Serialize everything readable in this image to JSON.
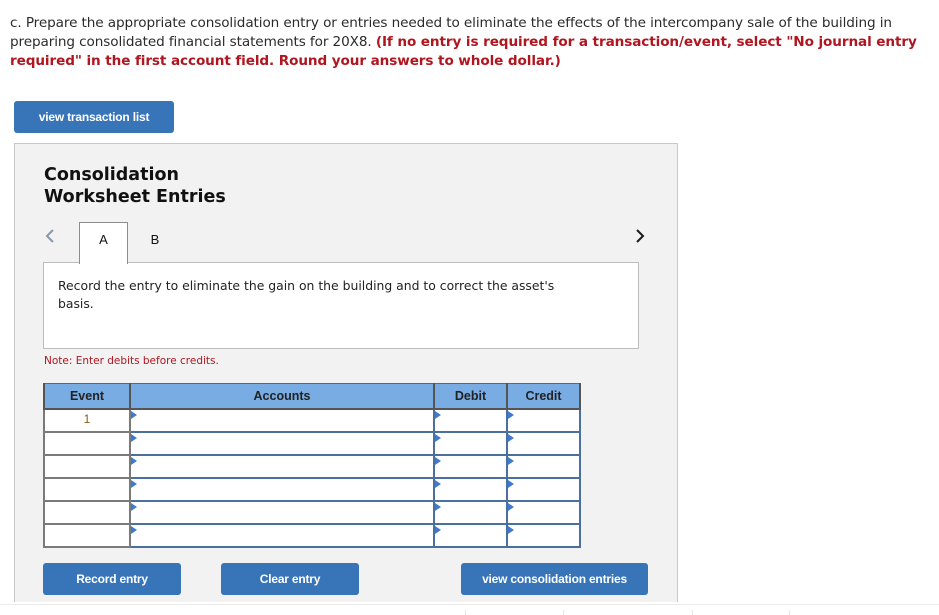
{
  "question": {
    "prefix": "c. Prepare the appropriate consolidation entry or entries needed to eliminate the effects of the intercompany sale of the building in preparing consolidated financial statements for 20X8. ",
    "instructions": "(If no entry is required for a transaction/event, select \"No journal entry required\" in the first account field. Round your answers to whole dollar.)"
  },
  "buttons": {
    "view_transaction_list": "view transaction list",
    "record_entry": "Record entry",
    "clear_entry": "Clear entry",
    "view_consolidation_entries": "view consolidation entries"
  },
  "panel": {
    "title_line1": "Consolidation",
    "title_line2": "Worksheet Entries",
    "tabs": [
      {
        "label": "A",
        "active": true
      },
      {
        "label": "B",
        "active": false
      }
    ],
    "description": "Record the entry to eliminate the gain on the building and to correct the asset's basis.",
    "note": "Note: Enter debits before credits.",
    "icons": {
      "prev": "chevron-left-icon",
      "next": "chevron-right-icon"
    }
  },
  "table": {
    "headers": [
      "Event",
      "Accounts",
      "Debit",
      "Credit"
    ],
    "rows": [
      {
        "event": "1",
        "account": "",
        "debit": "",
        "credit": ""
      },
      {
        "event": "",
        "account": "",
        "debit": "",
        "credit": ""
      },
      {
        "event": "",
        "account": "",
        "debit": "",
        "credit": ""
      },
      {
        "event": "",
        "account": "",
        "debit": "",
        "credit": ""
      },
      {
        "event": "",
        "account": "",
        "debit": "",
        "credit": ""
      },
      {
        "event": "",
        "account": "",
        "debit": "",
        "credit": ""
      }
    ]
  },
  "colors": {
    "button": "#3874b8",
    "instruction_red": "#b0161f",
    "header_blue": "#78ace3",
    "panel_bg": "#f2f2f2"
  }
}
